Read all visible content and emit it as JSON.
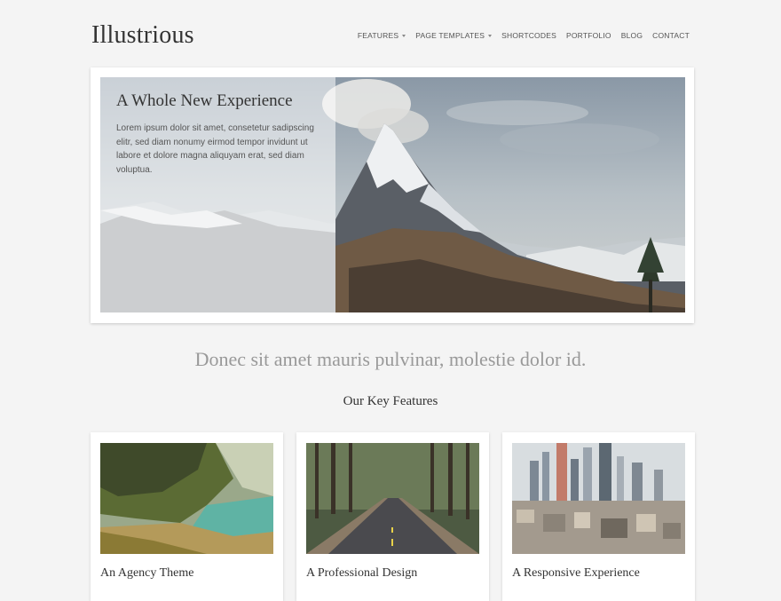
{
  "site": {
    "title": "Illustrious"
  },
  "nav": {
    "items": [
      {
        "label": "FEATURES",
        "has_dropdown": true
      },
      {
        "label": "PAGE TEMPLATES",
        "has_dropdown": true
      },
      {
        "label": "SHORTCODES",
        "has_dropdown": false
      },
      {
        "label": "PORTFOLIO",
        "has_dropdown": false
      },
      {
        "label": "BLOG",
        "has_dropdown": false
      },
      {
        "label": "CONTACT",
        "has_dropdown": false
      }
    ]
  },
  "hero": {
    "heading": "A Whole New Experience",
    "text": "Lorem ipsum dolor sit amet, consetetur sadipscing elitr, sed diam nonumy eirmod tempor invidunt ut labore et dolore magna aliquyam erat, sed diam voluptua."
  },
  "tagline": "Donec sit amet mauris pulvinar, molestie dolor id.",
  "features": {
    "heading": "Our Key Features",
    "cards": [
      {
        "title": "An Agency Theme"
      },
      {
        "title": "A Professional Design"
      },
      {
        "title": "A Responsive Experience"
      }
    ]
  },
  "colors": {
    "background": "#f4f4f4",
    "text": "#333333",
    "muted": "#999999"
  }
}
